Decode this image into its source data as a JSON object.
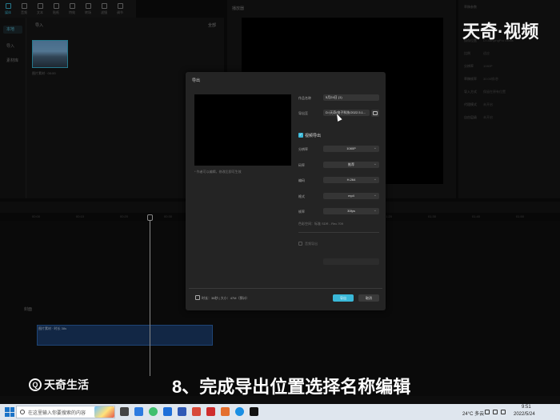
{
  "toolbar": {
    "tools": [
      "媒体",
      "音频",
      "文本",
      "贴纸",
      "特效",
      "转场",
      "滤镜",
      "调节"
    ]
  },
  "media": {
    "nav_local": "本地",
    "nav_import": "导入",
    "nav_library": "素材库",
    "header": "导入",
    "header_right": "全部",
    "thumb_caption": "图片素材 · 00:00"
  },
  "player": {
    "title": "播放器"
  },
  "properties": {
    "rows": [
      {
        "label": "草稿参数",
        "value": ""
      },
      {
        "label": "名称",
        "value": "5月24日"
      },
      {
        "label": "保存位置",
        "value": "D:/JianyingPro Drafts"
      },
      {
        "label": "比例",
        "value": "适应"
      },
      {
        "label": "分辨率",
        "value": "1080P"
      },
      {
        "label": "草稿帧率",
        "value": "30.00帧/秒"
      },
      {
        "label": "导入方式",
        "value": "保留在原有位置"
      },
      {
        "label": "代理模式",
        "value": "未开启"
      },
      {
        "label": "自由层级",
        "value": "未开启"
      }
    ]
  },
  "watermark_top": "天奇·视频",
  "timeline": {
    "ruler": [
      "00:00",
      "00:10",
      "00:20",
      "00:30",
      "00:40",
      "00:50",
      "01:00",
      "01:10",
      "01:20",
      "01:30",
      "01:40",
      "01:50"
    ],
    "track_label": "封面",
    "clip_title": "图片素材 · 时长 38s"
  },
  "dialog": {
    "title": "导出",
    "preview_hint": "* 作者可以编辑，修改后即可生效",
    "name_label": "作品名称",
    "name_value": "5月24日 (1)",
    "path_label": "导出至",
    "path_value": "D:/天奇/电子科技/2022.5.1...",
    "video_section": "视频导出",
    "fields": [
      {
        "label": "分辨率",
        "value": "1080P"
      },
      {
        "label": "码率",
        "value": "推荐"
      },
      {
        "label": "编码",
        "value": "H.264"
      },
      {
        "label": "格式",
        "value": "mp4"
      },
      {
        "label": "帧率",
        "value": "30fps"
      }
    ],
    "color_space": "色彩空间：标准 SDR - Rec.709",
    "audio_section": "音频导出",
    "size_info": "时长：38秒 | 大小：47M（预计）",
    "export_label": "导出",
    "cancel_label": "取消"
  },
  "logo_bottom": "天奇生活",
  "caption": "8、完成导出位置选择名称编辑",
  "taskbar": {
    "search_placeholder": "在这里输入你要搜索的内容",
    "weather": "24°C 多云",
    "time": "9:51",
    "date": "2022/5/24"
  }
}
